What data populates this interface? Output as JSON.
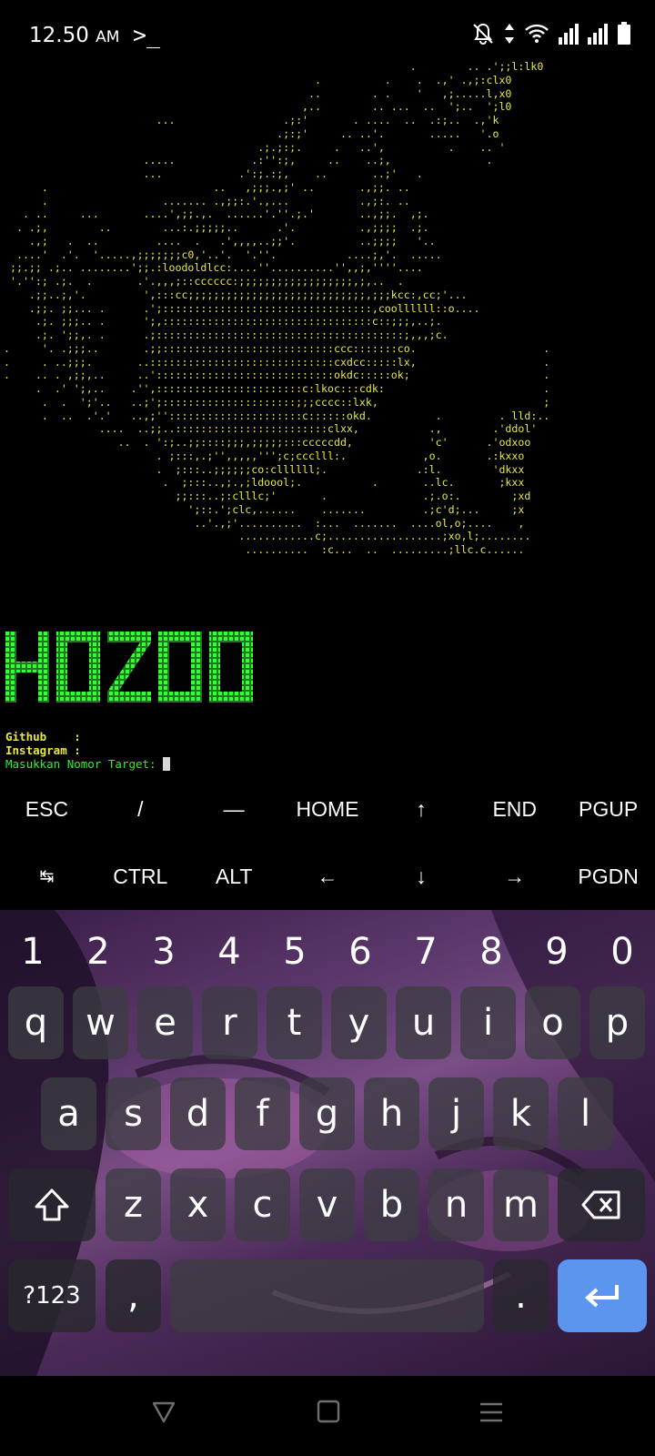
{
  "status_bar": {
    "time": "12.50",
    "ampm": "AM",
    "terminal_glyph": ">_",
    "icons": [
      "mute-bell-icon",
      "data-arrows-icon",
      "wifi-icon",
      "signal-1-icon",
      "signal-2-icon",
      "battery-icon"
    ]
  },
  "terminal": {
    "ascii_art": "                                                                .        .. .';;l:lk0\n                                                 .          .    .  .,' .,;:clx0\n                                                ..        . .    '   ,;.....l,x0\n                                               ,..        .. ...  ..  ';..  ';l0\n                        ...                 .;:'       . ....  ..  .:;..  .,'k\n                                           .;:;'     .. ..'.       .....   '.o\n                                        .;.;:;.     .   ..',          .    .. '\n                      .....            .:'':;,     ..    ..;,               .\n                      ...            .':;.:;,    ..       ..;'   .\n      .                          ..   ,;;;.,;' ..       .,;;. ..\n      .                  ....... .,;;:.'.,...           .,;:. ..\n   . ..     ...       ....',;;.,.  ......'.''.;.'       ..,;;.  ,;.\n  . .;,        ..        ...:.;;;;;..      .'.          .,;;;;  .;.\n    .,;   .  ..         ....  .   .',,,,..;;'.          ..;;;;   '..\n  ....'  .'.  '.....,;;;;;;;c0,'..'.  '.''.           ....;,'.  .....                   .\n ;;.;; .;.. ........';;.:loodoldlcc:....''..........'',,;,''''....                     .. .\n '.'':; .;.  .       .'.,,,;::cccccc:;;;;;;;;;;;;;;;;;;,;,..  .                         ''.\n    .;;..;,'.         ',:::cc;;;;;;;;;;;;;;;;;;;;;;;;;;;;,;;;kcc:,cc;'...                .'.\n    .;;. ;;... .      .';:::::::::::::::::::::::::::::::::,coollllll::o....              .. .\n     .;. ;;;.. .      ';,:::::::::::::::::::::::::::::::::c::;;;,..;.                 ..   'o\n     .;. ';;,. .      .;:::::::::::::::::::::::::::::::::::::::;,,,;c.                ..  ;:c\n.     '. .;;;..       .;;:::::::::::::::::::::::::::ccc:::::::co.                    .'  ;ld\n.     . ..;;;.       ..:::::::::::::::::::::::::::::cxdcc:::::lx,                    ..' .xo\n.    .. . ,;;,..     ..'::::::::::::::::::::::::::::okdc:::::ok;                     .,'. ld\n     .  .' ';,..    .'',:::::::::::::::::::::::c:lkoc:::cdk:                         .'c'..d\n      .  .  ';'..   ..;';:::::::::::::::::::::;;;cccc::lxk,                          ;o:'.c\n      .  ..  .'.'   ..,;'':::::::::::::::::::::c::::::okd.          .         . lld:..\n               ....  ..;;..::::::::::::::::::::::::clxx,           .,        .'ddol'\n                  ..  . ':;..;;::::;;;,;;;;;:::cccccdd,            'c'      .'odxoo\n                        . ;:::,.;'',,,,,''';c;ccclll:.            ,o.       .:kxxo\n                        .  ;:::..;;;;;;co:cllllll;.              .:l.        'dkxx\n                         .  ;:::..,;.,;ldoool;.           .       ..lc.       ;kxx\n                           ;;:::..;:clllc;'       .               .;.o:.        ;xd\n                             ';::.';clc,......    .......         .;c'd;...     ;x\n                              ..'.,;'..........  :...  .......  ....ol,o;....    ,\n                                     ............c;..................;xo,l;........\n                                      ..........  :c...  ..  .........;llc.c......",
    "banner_text": "HOZOO",
    "lines": [
      {
        "label": "Github",
        "sep": ":",
        "value": ""
      },
      {
        "label": "Instagram",
        "sep": ":",
        "value": ""
      }
    ],
    "prompt": "Masukkan Nomor Target: "
  },
  "extra_keys": {
    "row1": [
      "ESC",
      "/",
      "—",
      "HOME",
      "↑",
      "END",
      "PGUP"
    ],
    "row2": [
      "↹",
      "CTRL",
      "ALT",
      "←",
      "↓",
      "→",
      "PGDN"
    ]
  },
  "keyboard": {
    "numbers": [
      "1",
      "2",
      "3",
      "4",
      "5",
      "6",
      "7",
      "8",
      "9",
      "0"
    ],
    "row_q": [
      "q",
      "w",
      "e",
      "r",
      "t",
      "y",
      "u",
      "i",
      "o",
      "p"
    ],
    "row_a": [
      "a",
      "s",
      "d",
      "f",
      "g",
      "h",
      "j",
      "k",
      "l"
    ],
    "row_z": [
      "z",
      "x",
      "c",
      "v",
      "b",
      "n",
      "m"
    ],
    "symbols_key": "?123",
    "comma_key": ",",
    "period_key": ".",
    "colors": {
      "enter": "#5b95ee",
      "key": "#3c3c42",
      "terminal_green": "#2ef02e",
      "terminal_yellow": "#e9e93d"
    }
  },
  "nav_bar": {
    "buttons": [
      "back-icon",
      "home-icon",
      "recents-icon"
    ]
  }
}
